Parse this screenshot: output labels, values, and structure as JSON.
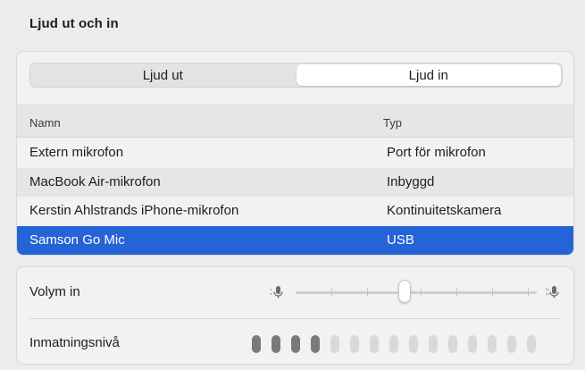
{
  "section_title": "Ljud ut och in",
  "tabs": [
    {
      "label": "Ljud ut",
      "active": false
    },
    {
      "label": "Ljud in",
      "active": true
    }
  ],
  "table": {
    "columns": [
      "Namn",
      "Typ"
    ],
    "rows": [
      {
        "name": "Extern mikrofon",
        "type": "Port för mikrofon"
      },
      {
        "name": "MacBook Air-mikrofon",
        "type": "Inbyggd"
      },
      {
        "name": "Kerstin Ahlstrands iPhone-mikrofon",
        "type": "Kontinuitetskamera"
      },
      {
        "name": "Samson Go Mic",
        "type": "USB"
      }
    ],
    "selected_index": 3
  },
  "input": {
    "volume_label": "Volym in",
    "volume_value": 0.45,
    "volume_low_icon": "mic-low-icon",
    "volume_high_icon": "mic-high-icon",
    "level_label": "Inmatningsnivå",
    "level_total_bars": 15,
    "level_active_bars": 4
  },
  "colors": {
    "selection": "#2464d6",
    "meter_on": "#7a7a7a",
    "meter_off": "#d9d9d9"
  }
}
